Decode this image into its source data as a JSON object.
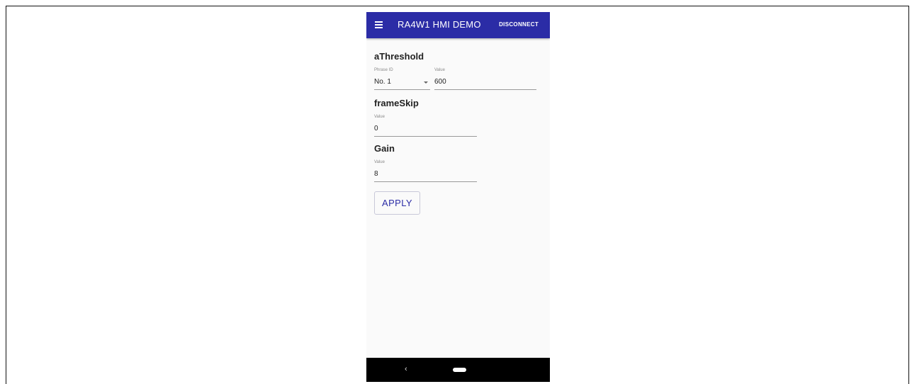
{
  "appbar": {
    "title": "RA4W1 HMI DEMO",
    "disconnect_label": "DISCONNECT",
    "menu_icon": "hamburger-menu-icon",
    "color": "#2b2ca6"
  },
  "athreshold": {
    "title": "aThreshold",
    "phrase_id_label": "Phrase ID",
    "phrase_id_value": "No. 1",
    "value_label": "Value",
    "value": "600"
  },
  "frameskip": {
    "title": "frameSkip",
    "value_label": "Value",
    "value": "0"
  },
  "gain": {
    "title": "Gain",
    "value_label": "Value",
    "value": "8"
  },
  "apply_label": "APPLY",
  "navbar": {
    "back_icon": "back-chevron-icon",
    "back_glyph": "‹",
    "home_icon": "home-pill-icon"
  }
}
